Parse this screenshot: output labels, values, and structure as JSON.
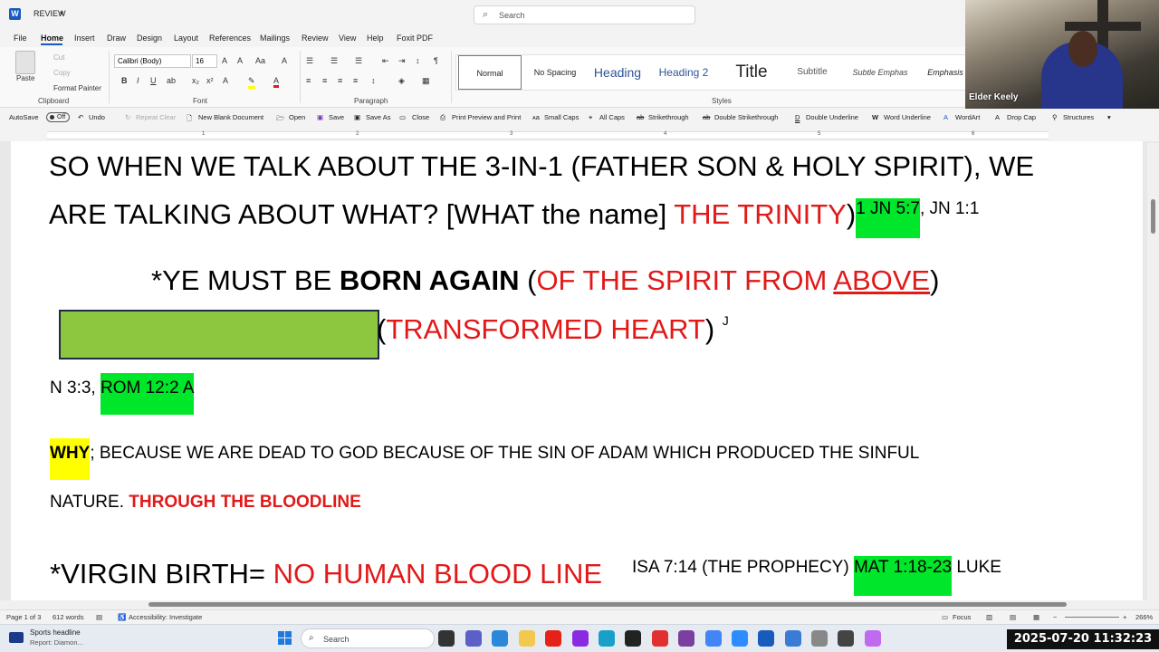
{
  "titlebar": {
    "doc_name": "REVIEW",
    "search_placeholder": "Search"
  },
  "menu": {
    "tabs": [
      "File",
      "Home",
      "Insert",
      "Draw",
      "Design",
      "Layout",
      "References",
      "Mailings",
      "Review",
      "View",
      "Help",
      "Foxit PDF"
    ]
  },
  "ribbon": {
    "clipboard": {
      "paste": "Paste",
      "cut": "Cut",
      "copy": "Copy",
      "format_painter": "Format Painter",
      "label": "Clipboard"
    },
    "font": {
      "family": "Calibri (Body)",
      "size": "16",
      "label": "Font"
    },
    "paragraph": {
      "label": "Paragraph"
    },
    "styles": {
      "label": "Styles",
      "items": [
        "Normal",
        "No Spacing",
        "Heading",
        "Heading 2",
        "Title",
        "Subtitle",
        "Subtle Emphas",
        "Emphasis"
      ]
    }
  },
  "qat": {
    "autosave": "AutoSave",
    "autosave_state": "Off",
    "undo": "Undo",
    "repeat": "Repeat Clear",
    "new_blank": "New Blank Document",
    "open": "Open",
    "save": "Save",
    "save_as": "Save As",
    "close": "Close",
    "print_preview": "Print Preview and Print",
    "small_caps": "Small Caps",
    "all_caps": "All Caps",
    "strikethrough": "Strikethrough",
    "double_strikethrough": "Double Strikethrough",
    "double_underline": "Double Underline",
    "word_underline": "Word Underline",
    "wordart": "WordArt",
    "drop_cap": "Drop Cap",
    "structures": "Structures"
  },
  "ruler": {
    "numbers": [
      "1",
      "2",
      "3",
      "4",
      "5",
      "6"
    ]
  },
  "video": {
    "name": "Elder Keely"
  },
  "document": {
    "l1": "SO WHEN WE TALK ABOUT THE 3-IN-1 (FATHER SON & HOLY SPIRIT), WE",
    "l2a": "ARE TALKING ABOUT WHAT? [WHAT the name] ",
    "l2b": "THE TRINITY",
    "l2c": ")",
    "l2d": "1 JN 5:7",
    "l2e": ", JN 1:1",
    "l3a": "*YE MUST BE ",
    "l3b": "BORN AGAIN",
    "l3c": " (",
    "l3d": "OF THE SPIRIT FROM ",
    "l3e": "ABOVE",
    "l3f": ")",
    "l4a": "(",
    "l4b": "TRANSFORMED HEART",
    "l4c": ") ",
    "l4d": "J",
    "l5a": "N 3:3, ",
    "l5b": "ROM 12:2 A",
    "l6a": "WHY",
    "l6b": "; BECAUSE WE ARE DEAD TO GOD BECAUSE OF THE SIN OF ADAM WHICH PRODUCED THE SINFUL",
    "l7a": "NATURE. ",
    "l7b": "THROUGH THE BLOODLINE",
    "l8a": "*VIRGIN BIRTH= ",
    "l8b": "NO HUMAN BLOOD LINE",
    "l8c": "ISA 7:14 (THE PROPHECY) ",
    "l8d": "MAT 1:18-23",
    "l8e": " LUKE"
  },
  "status": {
    "page": "Page 1 of 3",
    "words": "612 words",
    "accessibility": "Accessibility: Investigate",
    "focus": "Focus",
    "zoom": "266%"
  },
  "taskbar": {
    "news_title": "Sports headline",
    "news_sub": "Report: Diamon...",
    "search": "Search",
    "clock": "2025-07-20 11:32:23"
  },
  "colors": {
    "accent": "#185abd",
    "red_text": "#e11919",
    "highlight_green": "#00e62a",
    "highlight_yellow": "#ffff00",
    "box_green": "#8dc63f"
  }
}
